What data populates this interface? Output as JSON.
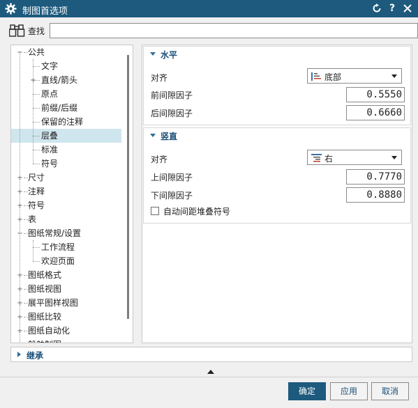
{
  "window": {
    "title": "制图首选项"
  },
  "search": {
    "label": "查找",
    "value": "",
    "placeholder": ""
  },
  "tree": [
    {
      "label": "公共",
      "expanded": true
    },
    {
      "label": "文字"
    },
    {
      "label": "直线/箭头",
      "collapsed": true
    },
    {
      "label": "原点"
    },
    {
      "label": "前缀/后缀"
    },
    {
      "label": "保留的注释"
    },
    {
      "label": "层叠",
      "selected": true
    },
    {
      "label": "标准"
    },
    {
      "label": "符号"
    },
    {
      "label": "尺寸",
      "collapsed": true
    },
    {
      "label": "注释",
      "collapsed": true
    },
    {
      "label": "符号",
      "collapsed": true
    },
    {
      "label": "表",
      "collapsed": true
    },
    {
      "label": "图纸常规/设置",
      "expanded": true
    },
    {
      "label": "工作流程"
    },
    {
      "label": "欢迎页面"
    },
    {
      "label": "图纸格式",
      "collapsed": true
    },
    {
      "label": "图纸视图",
      "collapsed": true
    },
    {
      "label": "展平图样视图",
      "collapsed": true
    },
    {
      "label": "图纸比较",
      "collapsed": true
    },
    {
      "label": "图纸自动化",
      "collapsed": true
    },
    {
      "label": "船舶制图",
      "collapsed": true
    }
  ],
  "horizontal": {
    "title": "水平",
    "align_label": "对齐",
    "align_value": "底部",
    "front_gap_label": "前间隙因子",
    "front_gap_value": "0.5550",
    "back_gap_label": "后间隙因子",
    "back_gap_value": "0.6660"
  },
  "vertical": {
    "title": "竖直",
    "align_label": "对齐",
    "align_value": "右",
    "top_gap_label": "上间隙因子",
    "top_gap_value": "0.7770",
    "bottom_gap_label": "下间隙因子",
    "bottom_gap_value": "0.8880",
    "auto_spacing_label": "自动间距堆叠符号",
    "auto_spacing_checked": false
  },
  "inherit": {
    "title": "继承"
  },
  "buttons": {
    "ok": "确定",
    "apply": "应用",
    "cancel": "取消"
  },
  "colors": {
    "titlebar": "#1d5a7d",
    "accent": "#1a4f78",
    "selected": "#cfe6ee"
  }
}
